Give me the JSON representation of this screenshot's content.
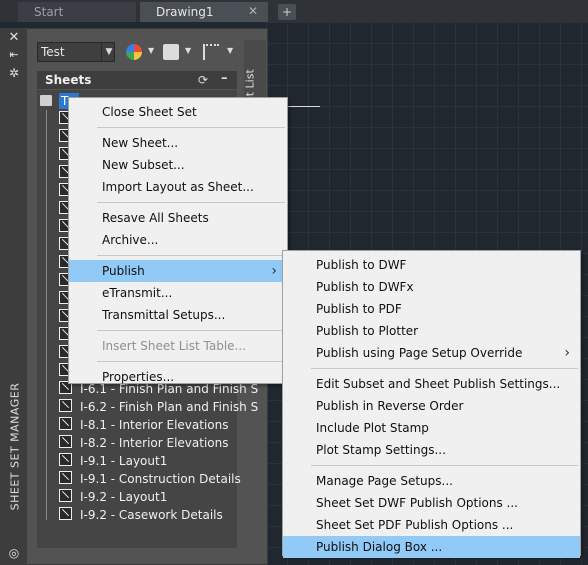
{
  "tabs": [
    {
      "label": "Start"
    },
    {
      "label": "Drawing1"
    }
  ],
  "palette": {
    "title": "SHEET SET MANAGER",
    "sheet_list_tab": "Sheet List",
    "combo_value": "Test",
    "sheets_header": "Sheets",
    "root_label": "T",
    "visible_sheets": [
      "I-6.1 - Finish Plan and Finish S",
      "I-6.2 - Finish Plan and Finish S",
      "I-8.1 - Interior Elevations",
      "I-8.2 - Interior Elevations",
      "I-9.1 - Layout1",
      "I-9.1 - Construction Details",
      "I-9.2 - Layout1",
      "I-9.2 - Casework Details"
    ]
  },
  "context_menu": {
    "groups": [
      [
        "Close Sheet Set"
      ],
      [
        "New Sheet...",
        "New Subset...",
        "Import Layout as Sheet..."
      ],
      [
        "Resave All Sheets",
        "Archive..."
      ],
      [
        "Publish",
        "eTransmit...",
        "Transmittal Setups..."
      ],
      [
        "Insert Sheet List Table..."
      ],
      [
        "Properties..."
      ]
    ],
    "highlighted": "Publish",
    "disabled": [
      "Insert Sheet List Table..."
    ]
  },
  "publish_submenu": {
    "groups": [
      [
        "Publish to DWF",
        "Publish to DWFx",
        "Publish to PDF",
        "Publish to Plotter",
        "Publish using Page Setup Override"
      ],
      [
        "Edit Subset and Sheet Publish Settings...",
        "Publish in Reverse Order",
        "Include Plot Stamp",
        "Plot Stamp Settings..."
      ],
      [
        "Manage Page Setups...",
        "Sheet Set DWF Publish Options ...",
        "Sheet Set PDF Publish Options ...",
        "Publish Dialog Box ..."
      ]
    ],
    "highlighted": "Publish Dialog Box ...",
    "has_submenu": [
      "Publish using Page Setup Override"
    ]
  },
  "colors": {
    "menu_highlight": "#91c9f7",
    "selection_blue": "#2b79d3",
    "palette_bg": "#535353",
    "canvas_bg": "#21272f"
  }
}
